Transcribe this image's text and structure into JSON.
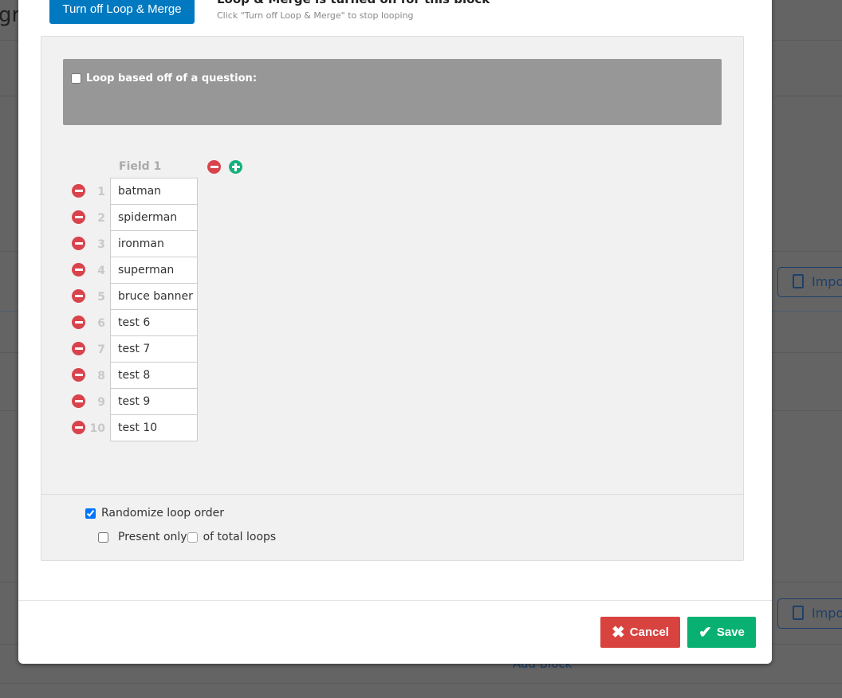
{
  "background": {
    "title_fragment": "gr",
    "import_label": "Impo",
    "add_block_label": "Add Block"
  },
  "header": {
    "turn_off_button": "Turn off Loop & Merge",
    "title": "Loop & Merge is turned on for this block",
    "subtitle": "Click \"Turn off Loop & Merge\" to stop looping"
  },
  "loop_question": {
    "label": "Loop based off of a question:",
    "checked": false
  },
  "field": {
    "header": "Field 1",
    "rows": [
      {
        "num": "1",
        "value": "batman"
      },
      {
        "num": "2",
        "value": "spiderman"
      },
      {
        "num": "3",
        "value": "ironman"
      },
      {
        "num": "4",
        "value": "superman"
      },
      {
        "num": "5",
        "value": "bruce banner"
      },
      {
        "num": "6",
        "value": "test 6"
      },
      {
        "num": "7",
        "value": "test 7"
      },
      {
        "num": "8",
        "value": "test 8"
      },
      {
        "num": "9",
        "value": "test 9"
      },
      {
        "num": "10",
        "value": "test 10"
      }
    ]
  },
  "options": {
    "randomize_label": "Randomize loop order",
    "randomize_checked": true,
    "present_only_label": "Present only",
    "present_only_value": "",
    "of_total_label": "of total loops",
    "present_only_checked": false
  },
  "footer": {
    "cancel_label": "Cancel",
    "save_label": "Save"
  },
  "colors": {
    "primary": "#0079c1",
    "cancel": "#d8433f",
    "save": "#08b172",
    "remove": "#d9434b",
    "add": "#16b07f"
  }
}
